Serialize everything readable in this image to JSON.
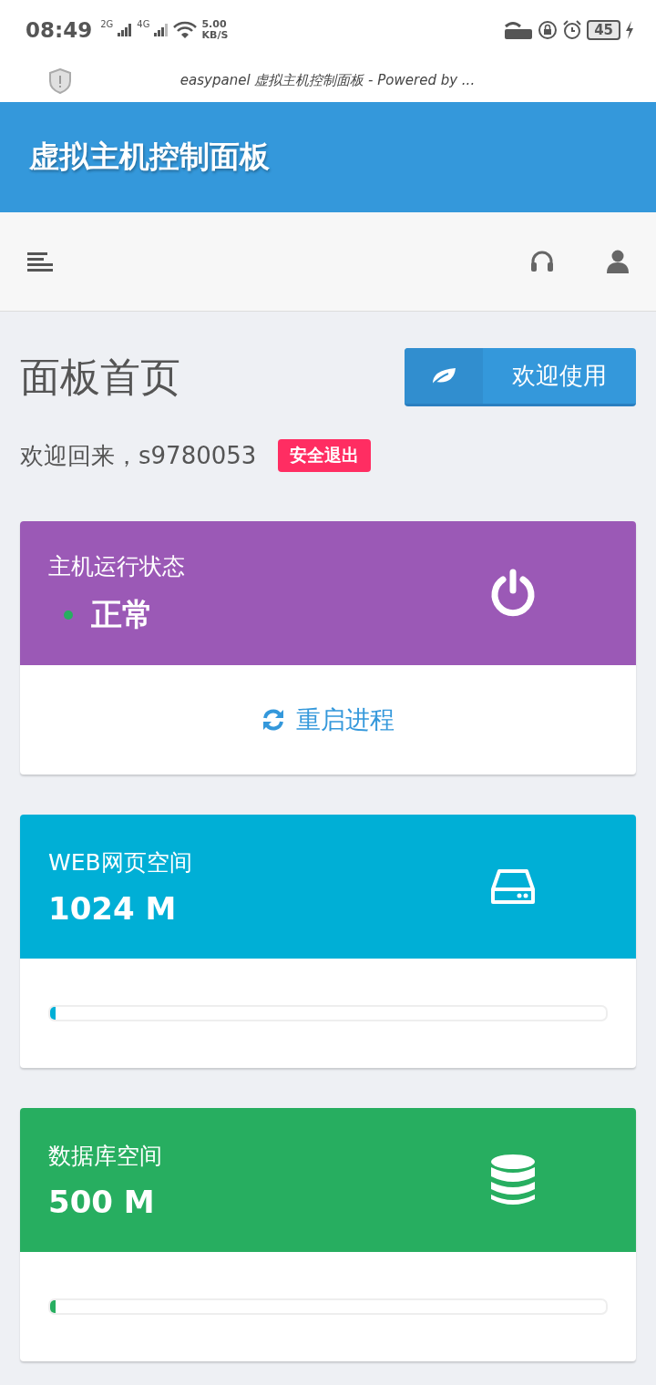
{
  "status_bar": {
    "time": "08:49",
    "sim1": "2G",
    "sim2": "4G",
    "speed": "5.00",
    "speed_unit": "KB/S",
    "battery": "45"
  },
  "browser": {
    "title": "easypanel 虚拟主机控制面板 - Powered by ..."
  },
  "header": {
    "title": "虚拟主机控制面板"
  },
  "page": {
    "title": "面板首页",
    "welcome_button": "欢迎使用",
    "greeting": "欢迎回来，s9780053",
    "logout": "安全退出"
  },
  "cards": [
    {
      "kind": "status",
      "label": "主机运行状态",
      "value": "正常",
      "color": "#27ae60",
      "action": "重启进程"
    },
    {
      "kind": "web",
      "label": "WEB网页空间",
      "value": "1024 M",
      "level": 0.01
    },
    {
      "kind": "database",
      "label": "数据库空间",
      "value": "500 M",
      "level": 0.01
    }
  ]
}
